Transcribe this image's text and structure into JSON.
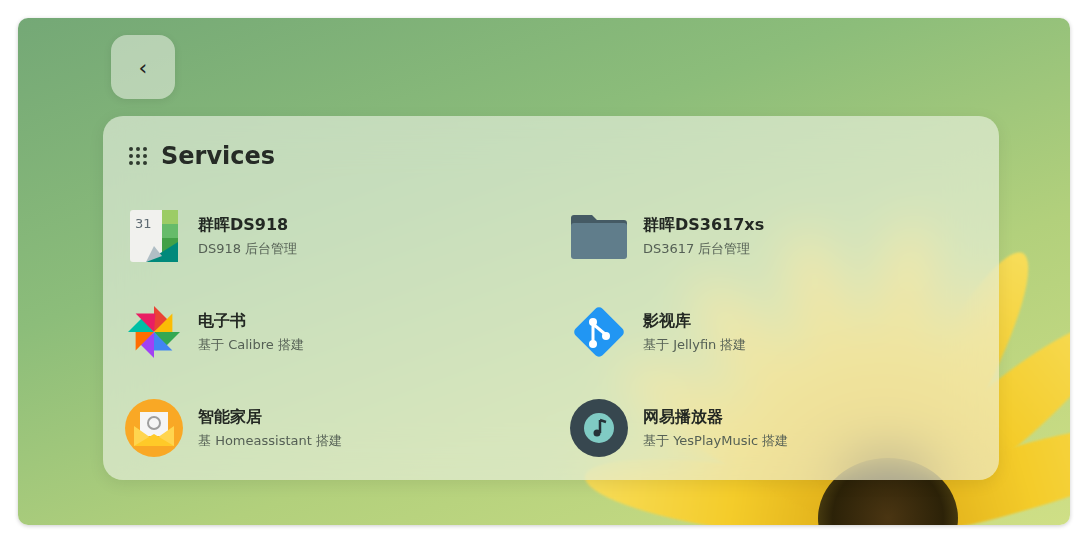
{
  "back_button": {
    "label": "‹"
  },
  "services": {
    "title": "Services",
    "items": [
      {
        "name": "群晖DS918",
        "description": "DS918 后台管理",
        "icon_label": "31"
      },
      {
        "name": "群晖DS3617xs",
        "description": "DS3617 后台管理"
      },
      {
        "name": "电子书",
        "description": "基于 Calibre 搭建"
      },
      {
        "name": "影视库",
        "description": "基于 Jellyfin 搭建"
      },
      {
        "name": "智能家居",
        "description": "基 Homeassistant 搭建"
      },
      {
        "name": "网易播放器",
        "description": "基于 YesPlayMusic 搭建"
      }
    ]
  }
}
